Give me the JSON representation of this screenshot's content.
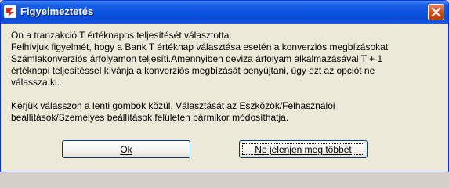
{
  "window": {
    "title": "Figyelmeztetés",
    "close_icon": "close-icon",
    "app_icon": "app-icon"
  },
  "message": {
    "lines": [
      "Ön a tranzakció  T értéknapos teljesítését választotta.",
      "Felhívjuk figyelmét, hogy a Bank  T értéknap választása esetén a konverziós megbízásokat",
      "Számlakonverziós árfolyamon teljesíti.Amennyiben deviza árfolyam alkalmazásával T + 1",
      "értéknapi teljesítéssel kívánja a konverziós megbízását benyújtani, úgy ezt az opciót ne",
      "válassza ki.",
      "",
      "Kérjük válasszon a lenti gombok közül. Választását az Eszközök/Felhasználói",
      "beállítások/Személyes beállítások felületen bármikor módosíthatja."
    ]
  },
  "buttons": {
    "ok_label": "Ok",
    "dont_show_label": "Ne jelenjen meg többet"
  },
  "colors": {
    "titlebar": "#0a52e0",
    "dialog_bg": "#ece9d8",
    "close_button": "#d44716"
  }
}
